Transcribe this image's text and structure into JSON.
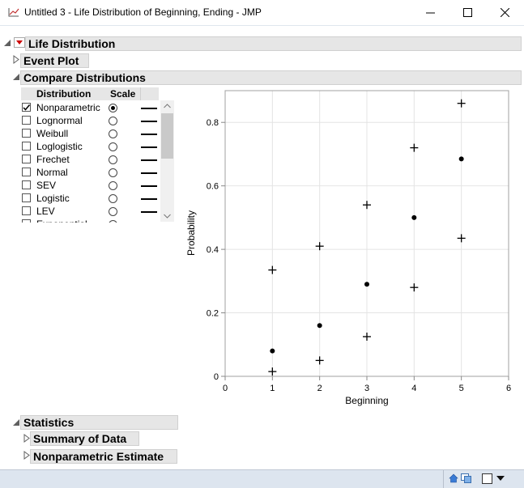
{
  "window": {
    "title": "Untitled 3 - Life Distribution of Beginning, Ending - JMP",
    "minimize_label": "—",
    "maximize_label": "☐",
    "close_label": "✕"
  },
  "sections": {
    "life_distribution": "Life Distribution",
    "event_plot": "Event Plot",
    "compare_distributions": "Compare Distributions",
    "statistics": "Statistics",
    "summary_of_data": "Summary of Data",
    "nonparametric_estimate": "Nonparametric Estimate"
  },
  "table": {
    "col_distribution": "Distribution",
    "col_scale": "Scale",
    "rows": [
      {
        "label": "Nonparametric",
        "checked": true,
        "scale_selected": true
      },
      {
        "label": "Lognormal",
        "checked": false,
        "scale_selected": false
      },
      {
        "label": "Weibull",
        "checked": false,
        "scale_selected": false
      },
      {
        "label": "Loglogistic",
        "checked": false,
        "scale_selected": false
      },
      {
        "label": "Frechet",
        "checked": false,
        "scale_selected": false
      },
      {
        "label": "Normal",
        "checked": false,
        "scale_selected": false
      },
      {
        "label": "SEV",
        "checked": false,
        "scale_selected": false
      },
      {
        "label": "Logistic",
        "checked": false,
        "scale_selected": false
      },
      {
        "label": "LEV",
        "checked": false,
        "scale_selected": false
      },
      {
        "label": "Exponential",
        "checked": false,
        "scale_selected": false
      }
    ]
  },
  "chart_data": {
    "type": "scatter",
    "xlabel": "Beginning",
    "ylabel": "Probability",
    "xlim": [
      0,
      6
    ],
    "ylim": [
      0,
      0.9
    ],
    "x_ticks": [
      "0",
      "1",
      "2",
      "3",
      "4",
      "5",
      "6"
    ],
    "y_ticks": [
      "0",
      "0.2",
      "0.4",
      "0.6",
      "0.8"
    ],
    "y_tick_values": [
      0,
      0.2,
      0.4,
      0.6,
      0.8
    ],
    "grid": true,
    "series": [
      {
        "marker": "dot",
        "points": [
          [
            1,
            0.08
          ],
          [
            2,
            0.16
          ],
          [
            3,
            0.29
          ],
          [
            4,
            0.5
          ],
          [
            5,
            0.685
          ]
        ]
      },
      {
        "marker": "plus",
        "points": [
          [
            1,
            0.335
          ],
          [
            2,
            0.41
          ],
          [
            3,
            0.54
          ],
          [
            4,
            0.72
          ],
          [
            5,
            0.86
          ]
        ]
      },
      {
        "marker": "plus",
        "points": [
          [
            1,
            0.015
          ],
          [
            2,
            0.05
          ],
          [
            3,
            0.125
          ],
          [
            4,
            0.28
          ],
          [
            5,
            0.435
          ]
        ]
      }
    ]
  },
  "colors": {
    "header_bg": "#e6e6e6",
    "status_bg": "#dde5ef",
    "red_arrow": "#cc0000",
    "grid": "#e4e4e4"
  },
  "icons": {
    "app": "chart-icon",
    "status_left": "home-icon",
    "status_right": "window-icon"
  }
}
